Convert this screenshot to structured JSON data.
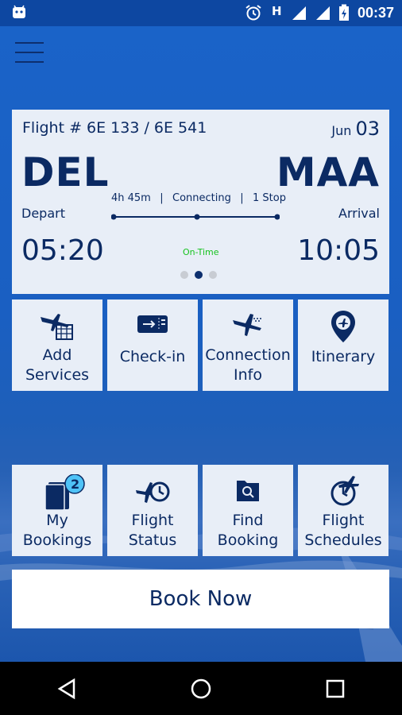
{
  "status_bar": {
    "time": "00:37",
    "icons": [
      "android-icon",
      "alarm-icon",
      "h-signal-icon",
      "signal-icon",
      "signal-icon",
      "battery-charging-icon"
    ]
  },
  "flight": {
    "number": "Flight # 6E 133 / 6E 541",
    "month": "Jun",
    "day": "03",
    "from_code": "DEL",
    "to_code": "MAA",
    "depart_label": "Depart",
    "arrival_label": "Arrival",
    "depart_time": "05:20",
    "arrival_time": "10:05",
    "duration": "4h 45m",
    "type": "Connecting",
    "stops": "1 Stop",
    "status": "On-Time",
    "pager_active": 1,
    "pager_count": 3
  },
  "tiles_top": [
    {
      "label_1": "Add",
      "label_2": "Services",
      "icon": "add-services-icon"
    },
    {
      "label_1": "Check-in",
      "label_2": "",
      "icon": "boarding-pass-icon"
    },
    {
      "label_1": "Connection",
      "label_2": "Info",
      "icon": "plane-icon"
    },
    {
      "label_1": "Itinerary",
      "label_2": "",
      "icon": "location-pin-icon"
    }
  ],
  "tiles_bottom": [
    {
      "label_1": "My",
      "label_2": "Bookings",
      "icon": "bookings-icon",
      "badge": "2"
    },
    {
      "label_1": "Flight",
      "label_2": "Status",
      "icon": "flight-status-icon"
    },
    {
      "label_1": "Find",
      "label_2": "Booking",
      "icon": "find-booking-icon"
    },
    {
      "label_1": "Flight",
      "label_2": "Schedules",
      "icon": "flight-schedules-icon"
    }
  ],
  "book_now_label": "Book Now",
  "colors": {
    "primary": "#1565c0",
    "dark_blue": "#0b2a63",
    "card": "#e8eef7",
    "on_time": "#17c31f"
  }
}
